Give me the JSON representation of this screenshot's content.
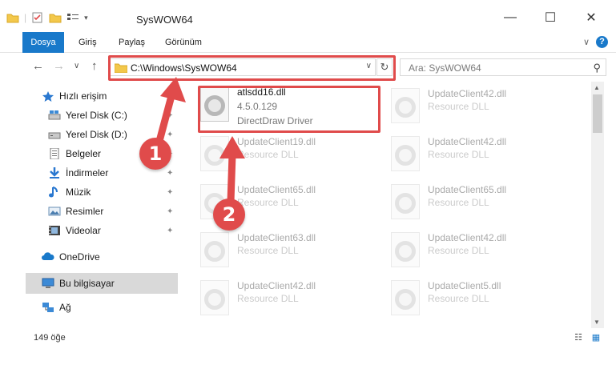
{
  "window": {
    "title": "SysWOW64",
    "minimize": "—",
    "maximize": "☐",
    "close": "✕"
  },
  "ribbon": {
    "tabs": [
      "Dosya",
      "Giriş",
      "Paylaş",
      "Görünüm"
    ],
    "expand_glyph": "∨",
    "help_glyph": "?"
  },
  "navigation": {
    "back": "←",
    "forward": "→",
    "recent": "∨",
    "up": "↑",
    "address": "C:\\Windows\\SysWOW64",
    "address_dropdown": "∨",
    "refresh": "↻",
    "search_placeholder": "Ara: SysWOW64",
    "search_glyph": "⚲"
  },
  "sidebar": {
    "quick_access": "Hızlı erişim",
    "items": [
      {
        "label": "Yerel Disk (C:)",
        "icon": "drive-icon",
        "pinned": true
      },
      {
        "label": "Yerel Disk (D:)",
        "icon": "drive-icon",
        "pinned": true
      },
      {
        "label": "Belgeler",
        "icon": "documents-icon",
        "pinned": true
      },
      {
        "label": "İndirmeler",
        "icon": "downloads-icon",
        "pinned": true
      },
      {
        "label": "Müzik",
        "icon": "music-icon",
        "pinned": true
      },
      {
        "label": "Resimler",
        "icon": "pictures-icon",
        "pinned": true
      },
      {
        "label": "Videolar",
        "icon": "videos-icon",
        "pinned": true
      }
    ],
    "onedrive": "OneDrive",
    "this_pc": "Bu bilgisayar",
    "network": "Ağ",
    "pin_glyph": "📌"
  },
  "files": {
    "highlighted": {
      "name": "atlsdd16.dll",
      "version": "4.5.0.129",
      "description": "DirectDraw Driver"
    },
    "left_column": [
      {
        "name": "UpdateClient19.dll",
        "description": "Resource DLL"
      },
      {
        "name": "UpdateClient65.dll",
        "description": "Resource DLL"
      },
      {
        "name": "UpdateClient63.dll",
        "description": "Resource DLL"
      },
      {
        "name": "UpdateClient42.dll",
        "description": "Resource DLL"
      }
    ],
    "right_column": [
      {
        "name": "UpdateClient42.dll",
        "description": "Resource DLL"
      },
      {
        "name": "UpdateClient42.dll",
        "description": "Resource DLL"
      },
      {
        "name": "UpdateClient65.dll",
        "description": "Resource DLL"
      },
      {
        "name": "UpdateClient42.dll",
        "description": "Resource DLL"
      },
      {
        "name": "UpdateClient5.dll",
        "description": "Resource DLL"
      }
    ]
  },
  "status": {
    "item_count": "149 öğe",
    "details_view_glyph": "☷",
    "tiles_view_glyph": "▦"
  },
  "annotations": {
    "step1": "1",
    "step2": "2"
  },
  "colors": {
    "accent": "#1979ca",
    "highlight": "#e04b4b",
    "folder": "#f3c84b"
  }
}
